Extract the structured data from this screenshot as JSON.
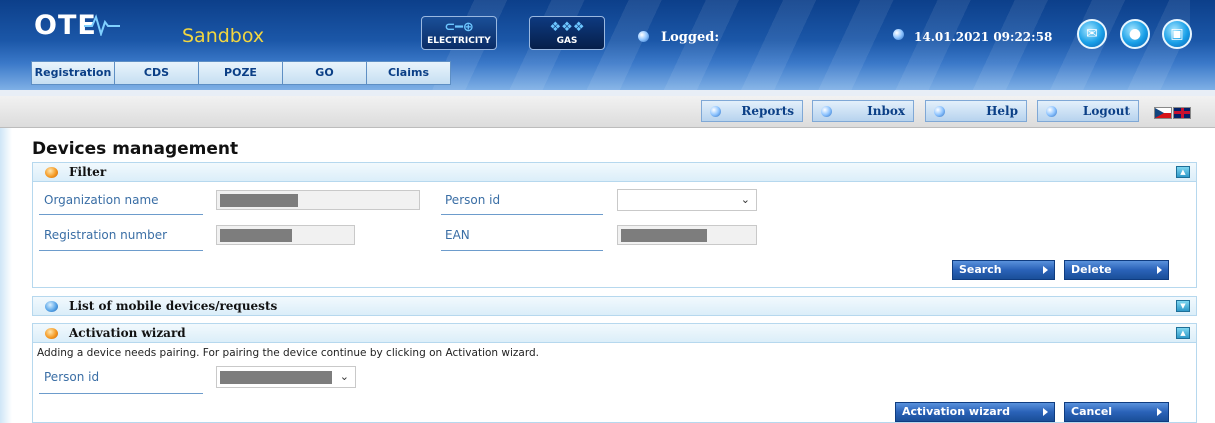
{
  "header": {
    "logo_text": "OTE",
    "environment": "Sandbox",
    "commodities": [
      {
        "label": "ELECTRICITY",
        "icon": "plug-icon"
      },
      {
        "label": "GAS",
        "icon": "flame-icon"
      }
    ],
    "logged_label": "Logged:",
    "datetime": "14.01.2021 09:22:58",
    "round_buttons": [
      "mail-icon",
      "chat-icon",
      "windows-icon"
    ]
  },
  "nav": {
    "items": [
      "Registration",
      "CDS",
      "POZE",
      "GO",
      "Claims"
    ]
  },
  "toolbar": {
    "reports": "Reports",
    "inbox": "Inbox",
    "help": "Help",
    "logout": "Logout",
    "languages": [
      "cz-flag-icon",
      "uk-flag-icon"
    ]
  },
  "page": {
    "title": "Devices management"
  },
  "filter": {
    "title": "Filter",
    "org_name_label": "Organization name",
    "person_id_label": "Person id",
    "reg_number_label": "Registration number",
    "ean_label": "EAN",
    "search_label": "Search",
    "delete_label": "Delete"
  },
  "list_panel": {
    "title": "List of mobile devices/requests"
  },
  "wizard": {
    "title": "Activation wizard",
    "info": "Adding a device needs pairing. For pairing the device continue by clicking on Activation wizard.",
    "person_id_label": "Person id",
    "activation_label": "Activation wizard",
    "cancel_label": "Cancel"
  },
  "colors": {
    "header_blue": "#1b57a8",
    "sandbox_yellow": "#f2d640",
    "label_blue": "#3a6ea5",
    "button_blue": "#2a62b8"
  }
}
